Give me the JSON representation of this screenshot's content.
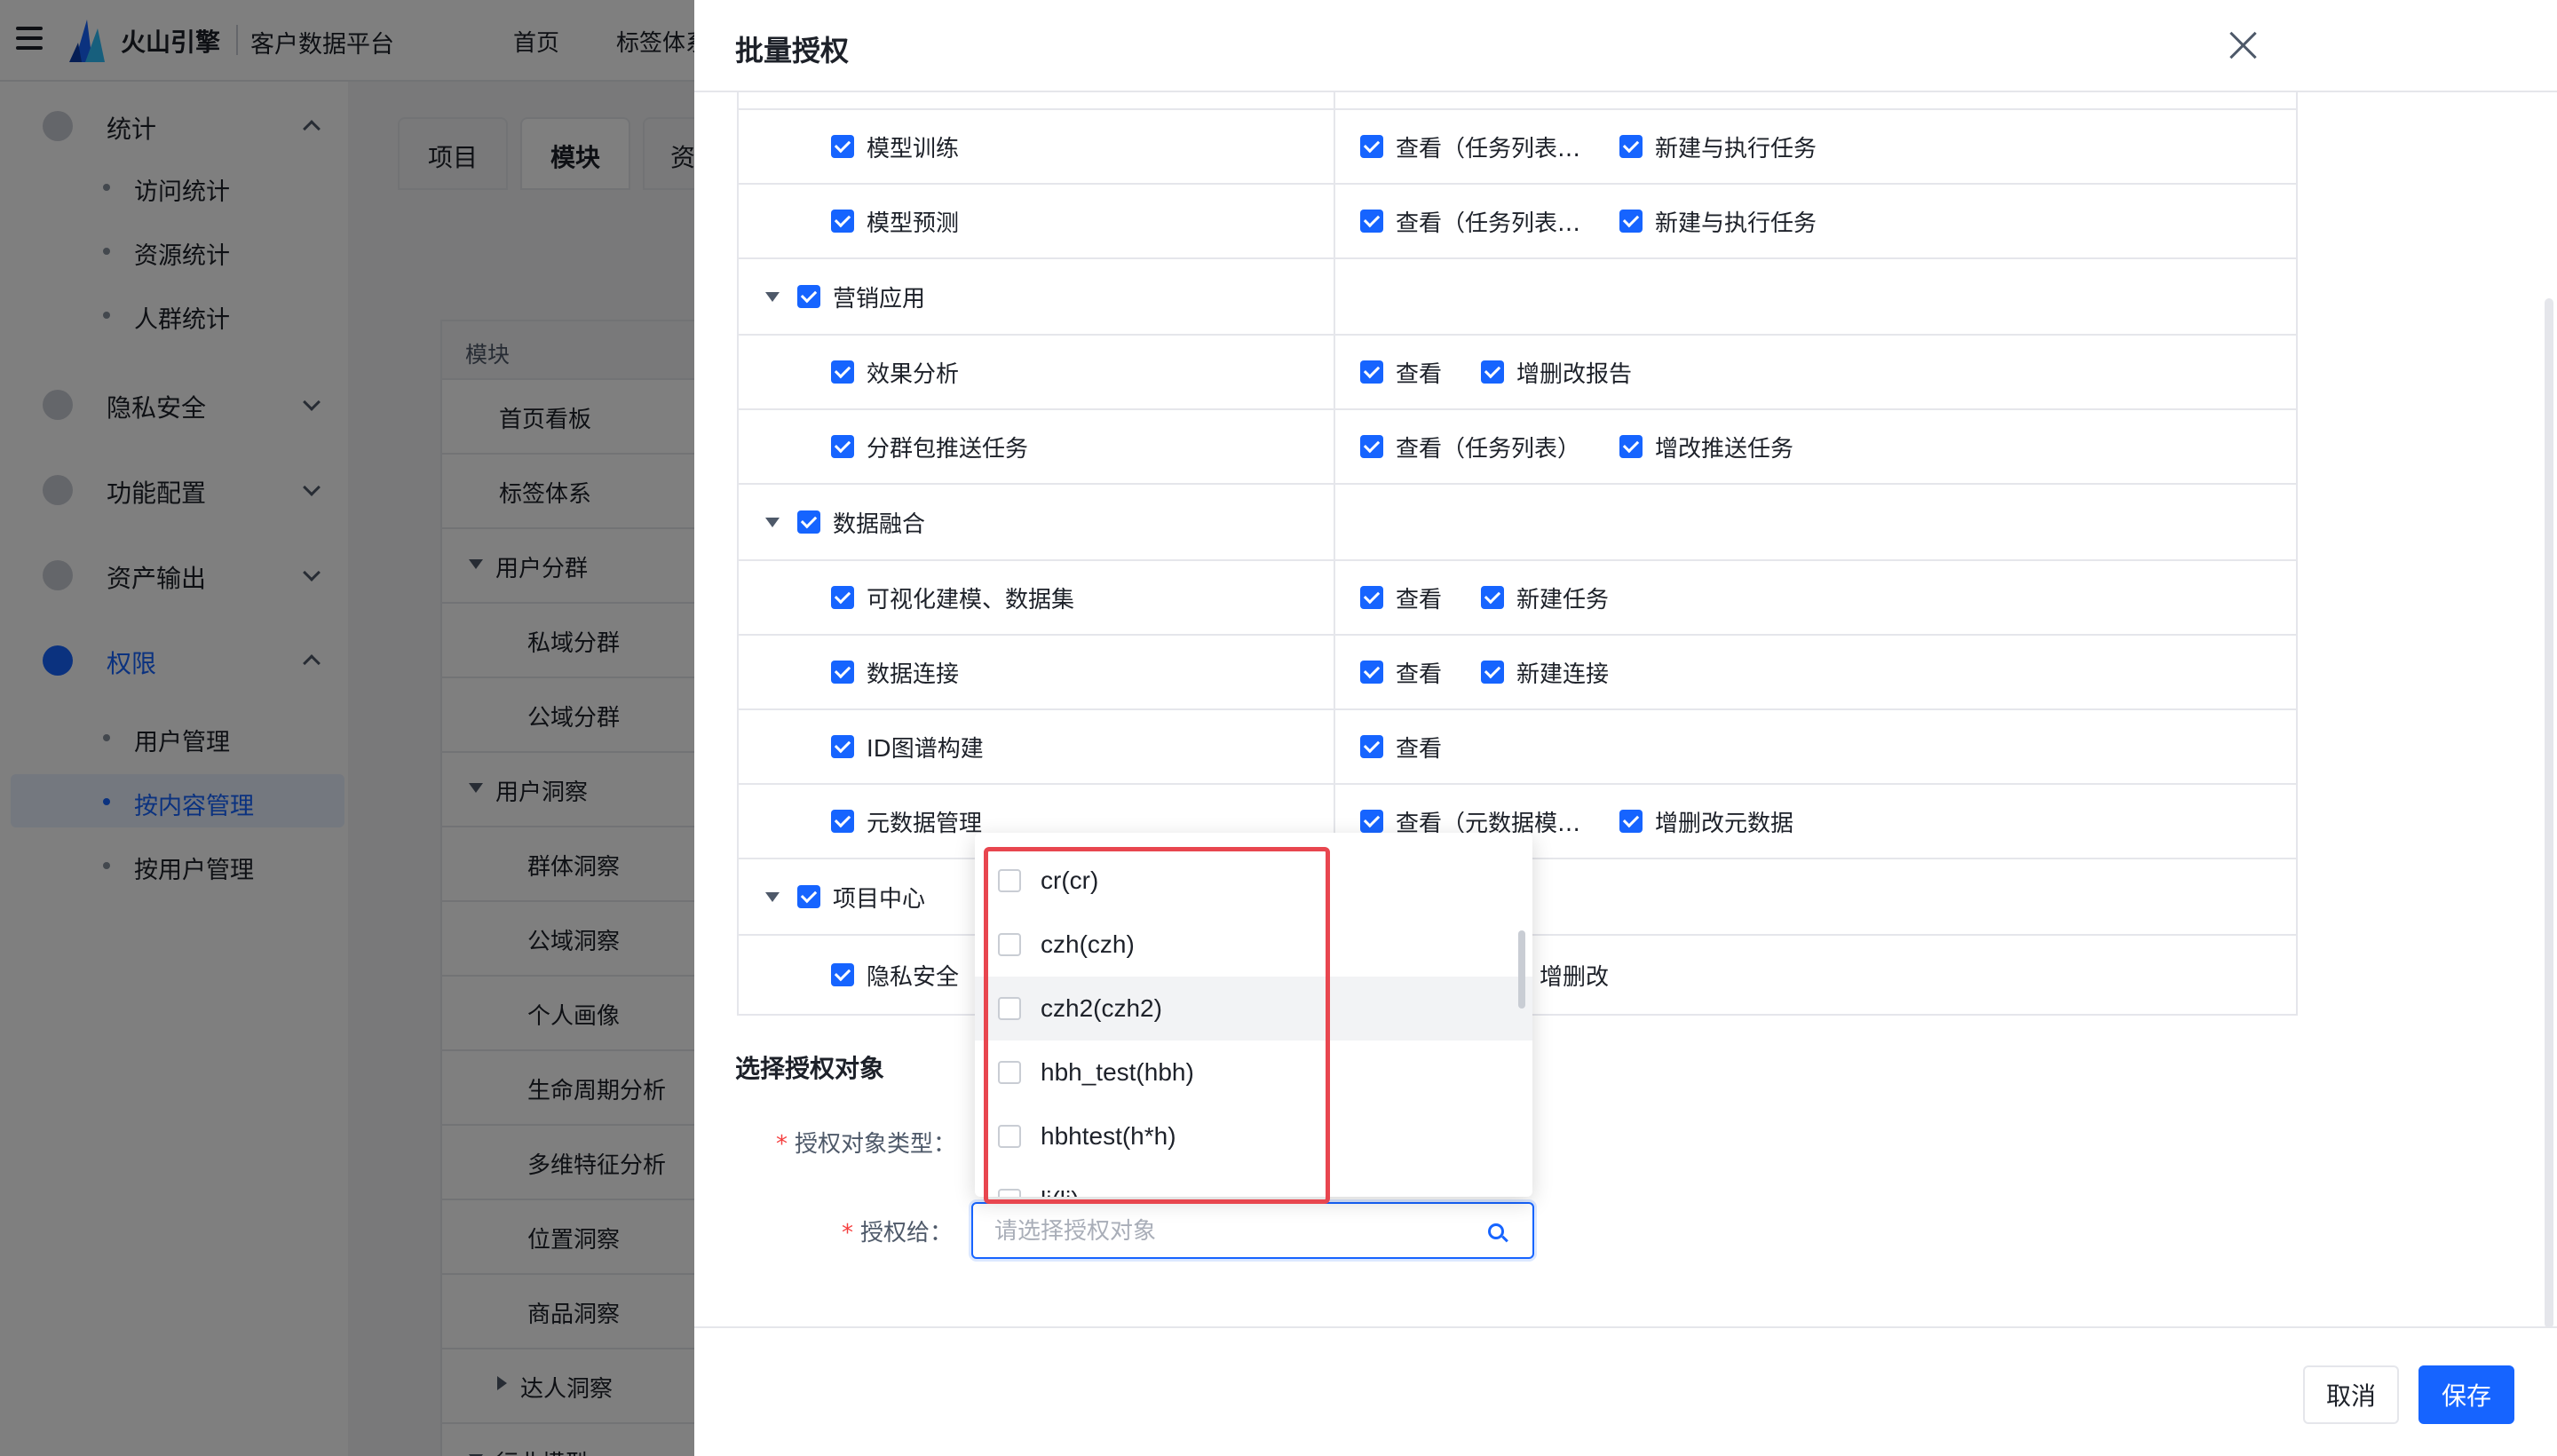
{
  "app": {
    "brand": "火山引擎",
    "product": "客户数据平台",
    "top_nav": [
      "首页",
      "标签体系"
    ]
  },
  "sidebar": {
    "groups": [
      {
        "label": "统计",
        "expanded": true,
        "items": [
          "访问统计",
          "资源统计",
          "人群统计"
        ]
      },
      {
        "label": "隐私安全",
        "expanded": false,
        "items": []
      },
      {
        "label": "功能配置",
        "expanded": false,
        "items": []
      },
      {
        "label": "资产输出",
        "expanded": false,
        "items": []
      },
      {
        "label": "权限",
        "expanded": true,
        "active": true,
        "items": [
          "用户管理",
          "按内容管理",
          "按用户管理"
        ]
      }
    ],
    "active_item": "按内容管理"
  },
  "tabs": [
    "项目",
    "模块",
    "资"
  ],
  "module_tree": {
    "header": "模块",
    "rows": [
      "首页看板",
      "标签体系",
      "用户分群",
      "私域分群",
      "公域分群",
      "用户洞察",
      "群体洞察",
      "公域洞察",
      "个人画像",
      "生命周期分析",
      "多维特征分析",
      "位置洞察",
      "商品洞察",
      "达人洞察",
      "行业模型"
    ]
  },
  "drawer": {
    "title": "批量授权",
    "permissions": [
      {
        "name": "模型训练",
        "level": 2,
        "actions": [
          "查看（任务列表…",
          "新建与执行任务"
        ]
      },
      {
        "name": "模型预测",
        "level": 2,
        "actions": [
          "查看（任务列表…",
          "新建与执行任务"
        ]
      },
      {
        "name": "营销应用",
        "level": 1,
        "actions": []
      },
      {
        "name": "效果分析",
        "level": 2,
        "actions": [
          "查看",
          "增删改报告"
        ]
      },
      {
        "name": "分群包推送任务",
        "level": 2,
        "actions": [
          "查看（任务列表）",
          "增改推送任务"
        ]
      },
      {
        "name": "数据融合",
        "level": 1,
        "actions": []
      },
      {
        "name": "可视化建模、数据集",
        "level": 2,
        "actions": [
          "查看",
          "新建任务"
        ]
      },
      {
        "name": "数据连接",
        "level": 2,
        "actions": [
          "查看",
          "新建连接"
        ]
      },
      {
        "name": "ID图谱构建",
        "level": 2,
        "actions": [
          "查看"
        ]
      },
      {
        "name": "元数据管理",
        "level": 2,
        "actions": [
          "查看（元数据模…",
          "增删改元数据"
        ]
      },
      {
        "name": "项目中心",
        "level": 1,
        "actions": []
      },
      {
        "name": "隐私安全",
        "level": 2,
        "actions": [
          "…、…",
          "增删改"
        ]
      }
    ],
    "section_title": "选择授权对象",
    "object_type_label": "授权对象类型：",
    "grant_to_label": "授权给：",
    "grant_placeholder": "请选择授权对象",
    "dropdown_options": [
      "cr(cr)",
      "czh(czh)",
      "czh2(czh2)",
      "hbh_test(hbh)",
      "hbhtest(h*h)",
      "lj(lj)"
    ],
    "hovered_option": "czh2(czh2)",
    "cancel_label": "取消",
    "save_label": "保存"
  },
  "colors": {
    "primary": "#1664ff",
    "highlight": "#e8464f",
    "required": "#f53f3f"
  }
}
